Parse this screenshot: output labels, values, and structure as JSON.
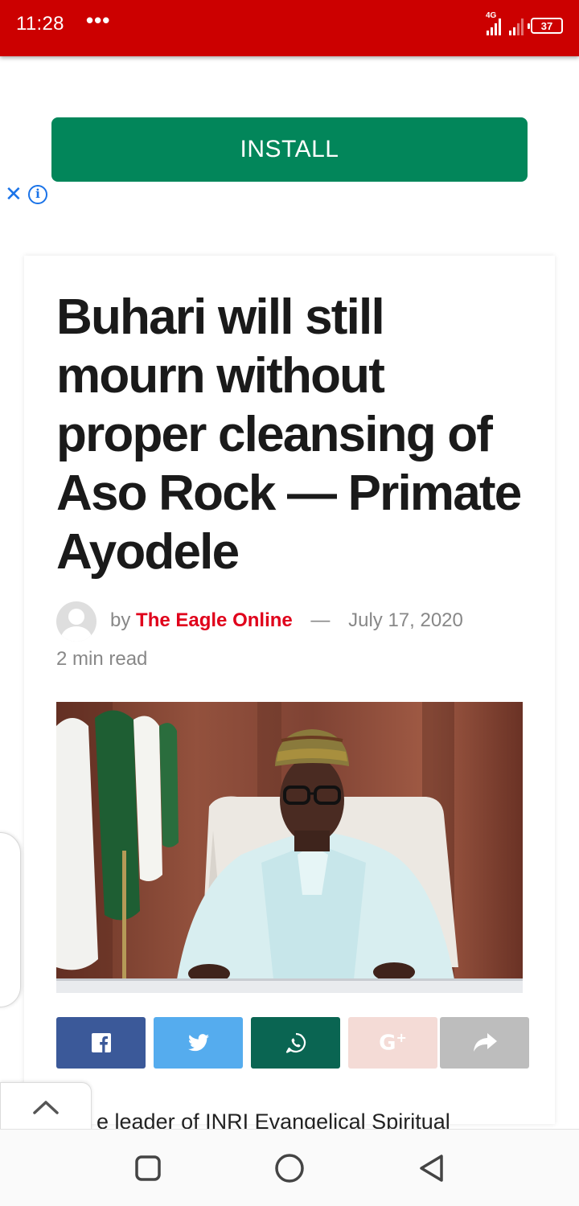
{
  "status_bar": {
    "time": "11:28",
    "dots": "•••",
    "network": "4G",
    "battery": "37",
    "color": "#cc0000"
  },
  "ad": {
    "install_label": "INSTALL",
    "close_glyph": "✕",
    "info_glyph": "i",
    "button_color": "#02865a"
  },
  "article": {
    "headline": "Buhari will still mourn without proper cleansing of Aso Rock — Primate Ayodele",
    "by_label": "by",
    "author": "The Eagle Online",
    "separator": "—",
    "date": "July 17, 2020",
    "read_time": "2 min read",
    "body_excerpt": "e leader of INRI Evangelical Spiritual",
    "author_color": "#e0001b"
  },
  "share": [
    {
      "name": "facebook",
      "icon": "facebook-icon",
      "color": "#3b5999"
    },
    {
      "name": "twitter",
      "icon": "twitter-icon",
      "color": "#55acee"
    },
    {
      "name": "whatsapp",
      "icon": "whatsapp-icon",
      "color": "#0a6552"
    },
    {
      "name": "google-plus",
      "icon": "google-plus-icon",
      "color": "#f4dbd6"
    },
    {
      "name": "share",
      "icon": "share-arrow-icon",
      "color": "#bdbdbd"
    }
  ],
  "nav": {
    "buttons": [
      "recent-apps-icon",
      "home-icon",
      "back-icon"
    ]
  }
}
